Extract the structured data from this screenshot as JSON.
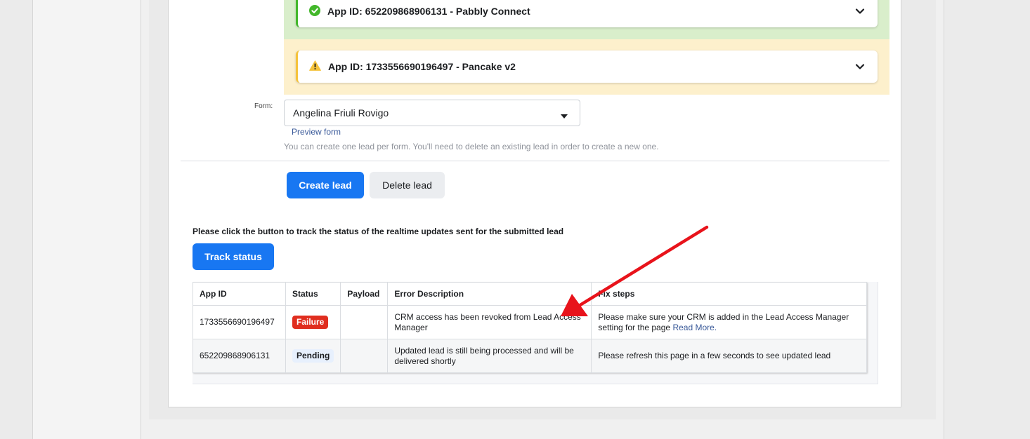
{
  "apps": [
    {
      "status": "success",
      "label": "App ID: 652209868906131 - Pabbly Connect"
    },
    {
      "status": "warning",
      "label": "App ID: 1733556690196497 - Pancake v2"
    }
  ],
  "form": {
    "label": "Form:",
    "selected": "Angelina Friuli Rovigo",
    "preview_link": "Preview form",
    "hint": "You can create one lead per form. You'll need to delete an existing lead in order to create a new one."
  },
  "actions": {
    "create": "Create lead",
    "delete": "Delete lead"
  },
  "track": {
    "text": "Please click the button to track the status of the realtime updates sent for the submitted lead",
    "button": "Track status"
  },
  "table": {
    "headers": [
      "App ID",
      "Status",
      "Payload",
      "Error Description",
      "Fix steps"
    ],
    "rows": [
      {
        "app_id": "1733556690196497",
        "status": "Failure",
        "payload": "",
        "error": "CRM access has been revoked from Lead Access Manager",
        "fix": "Please make sure your CRM is added in the Lead Access Manager setting for the page",
        "fix_link": "Read More."
      },
      {
        "app_id": "652209868906131",
        "status": "Pending",
        "payload": "",
        "error": "Updated lead is still being processed and will be delivered shortly",
        "fix": "Please refresh this page in a few seconds to see updated lead",
        "fix_link": ""
      }
    ]
  },
  "colors": {
    "primary": "#1877f2",
    "success": "#42b72a",
    "warning": "#f5c33b",
    "failure": "#e02e1f",
    "annotation_arrow": "#e8131b"
  },
  "icons": [
    "check-circle-icon",
    "warning-triangle-icon",
    "chevron-down-icon",
    "caret-down-icon",
    "annotation-arrow"
  ]
}
